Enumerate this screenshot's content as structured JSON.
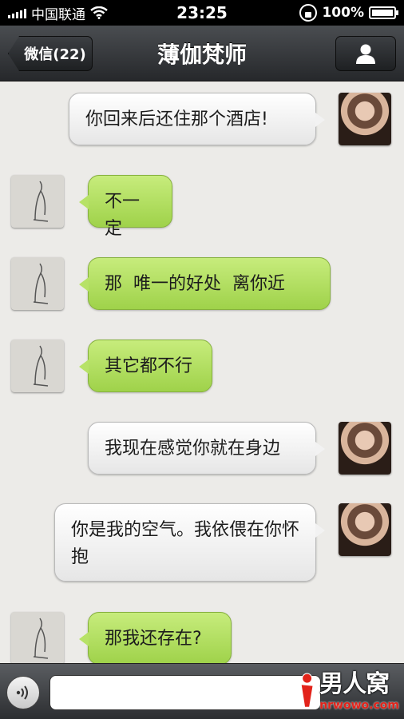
{
  "status_bar": {
    "carrier": "中国联通",
    "time": "23:25",
    "battery": "100%"
  },
  "nav": {
    "back_label": "微信(22)",
    "title": "薄伽梵师"
  },
  "messages": [
    {
      "side": "right",
      "text": "你回来后还住那个酒店!"
    },
    {
      "side": "left",
      "text": "不一定"
    },
    {
      "side": "left",
      "text": "那  唯一的好处  离你近"
    },
    {
      "side": "left",
      "text": "其它都不行"
    },
    {
      "side": "right",
      "text": "我现在感觉你就在身边"
    },
    {
      "side": "right",
      "text": "你是我的空气。我依偎在你怀抱"
    },
    {
      "side": "left",
      "text": "那我还存在?"
    }
  ],
  "input": {
    "value": "",
    "placeholder": ""
  },
  "watermark": {
    "title": "男人窝",
    "subtitle": "nrwowo.com"
  },
  "colors": {
    "incoming_bubble": "#b7e267",
    "outgoing_bubble": "#f2f2f2",
    "navbar": "#2e3033"
  }
}
